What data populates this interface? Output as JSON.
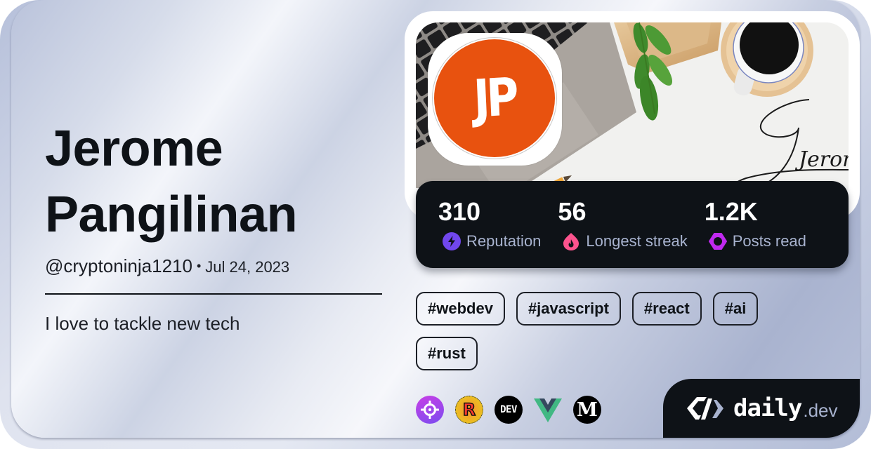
{
  "profile": {
    "name": "Jerome Pangilinan",
    "username": "@cryptoninja1210",
    "separator": "•",
    "joined": "Jul 24, 2023",
    "bio": "I love to tackle new tech"
  },
  "avatar": {
    "initials": "JP",
    "color": "#e8520f"
  },
  "cover": {
    "signature_text": "Jerom"
  },
  "stats": [
    {
      "value": "310",
      "label": "Reputation",
      "icon": "reputation-bolt-icon",
      "color": "#7147ed"
    },
    {
      "value": "56",
      "label": "Longest streak",
      "icon": "streak-flame-icon",
      "color": "#fc538d"
    },
    {
      "value": "1.2K",
      "label": "Posts read",
      "icon": "posts-read-eye-icon",
      "color": "#c029f0"
    }
  ],
  "tags": [
    "#webdev",
    "#javascript",
    "#react",
    "#ai",
    "#rust"
  ],
  "sources": [
    {
      "name": "target-source-icon"
    },
    {
      "name": "rust-source-icon",
      "glyph": "R"
    },
    {
      "name": "dev-to-source-icon",
      "glyph": "DEV"
    },
    {
      "name": "vue-source-icon"
    },
    {
      "name": "medium-source-icon",
      "glyph": "M"
    }
  ],
  "brand": {
    "name": "daily",
    "suffix": ".dev"
  }
}
